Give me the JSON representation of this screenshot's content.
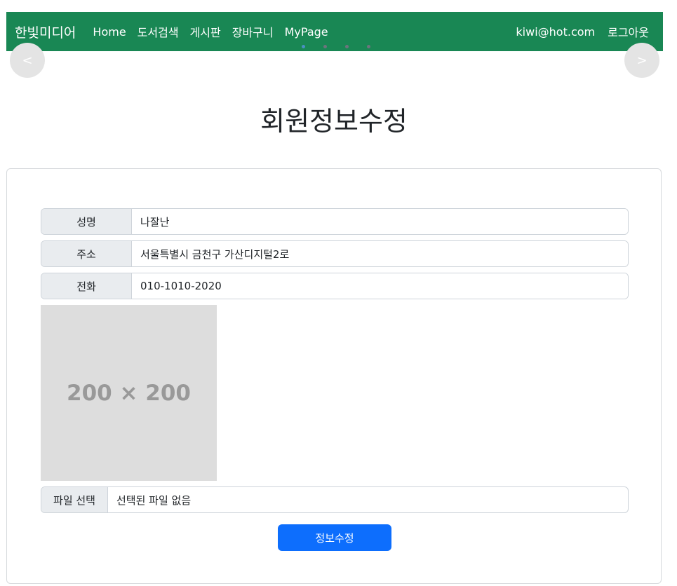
{
  "navbar": {
    "brand": "한빛미디어",
    "links": [
      "Home",
      "도서검색",
      "게시판",
      "장바구니",
      "MyPage"
    ],
    "user_email": "kiwi@hot.com",
    "logout": "로그아웃",
    "bg_color": "#198754"
  },
  "carousel": {
    "prev_label": "<",
    "next_label": ">",
    "indicator_count": 4,
    "active_index": 0
  },
  "page": {
    "title": "회원정보수정"
  },
  "form": {
    "name_label": "성명",
    "name_value": "나잘난",
    "address_label": "주소",
    "address_value": "서울특별시 금천구 가산디지털2로",
    "phone_label": "전화",
    "phone_value": "010-1010-2020",
    "photo_placeholder": "200 × 200",
    "file_button": "파일 선택",
    "file_status": "선택된 파일 없음",
    "submit_label": "정보수정",
    "submit_color": "#0d6efd"
  }
}
